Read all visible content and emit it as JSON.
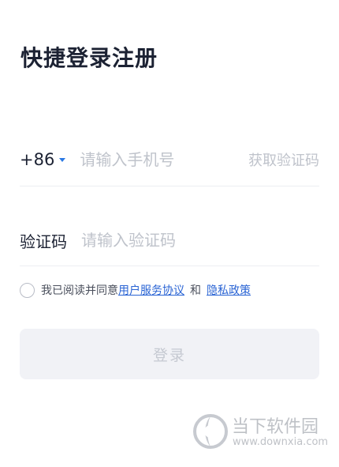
{
  "title": "快捷登录注册",
  "phone": {
    "country_code": "+86",
    "placeholder": "请输入手机号",
    "get_code_label": "获取验证码"
  },
  "code": {
    "label": "验证码",
    "placeholder": "请输入验证码"
  },
  "agreement": {
    "prefix": "我已阅读并同意",
    "terms_link": "用户服务协议",
    "conjunction": "和",
    "privacy_link": "隐私政策"
  },
  "login_button": {
    "label": "登录"
  },
  "watermark": {
    "name": "当下软件园",
    "url": "www.downxia.com"
  },
  "colors": {
    "title": "#1c2233",
    "link": "#2a64d4",
    "placeholder": "#bfc3cb",
    "button_bg": "#f1f2f6"
  }
}
